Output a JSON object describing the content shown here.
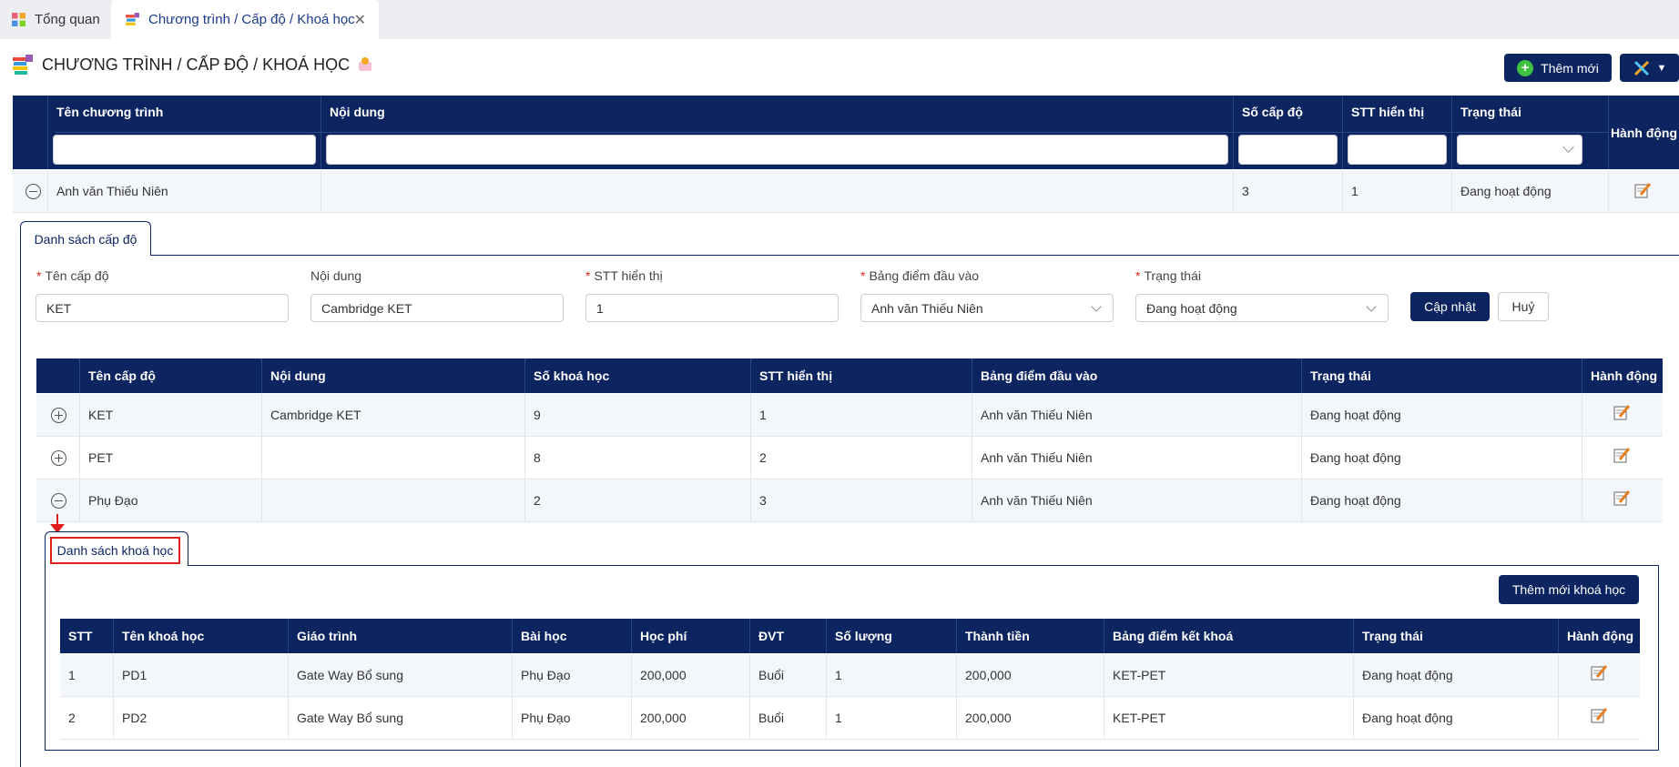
{
  "tabs": [
    {
      "label": "Tổng quan"
    },
    {
      "label": "Chương trình / Cấp độ / Khoá học"
    }
  ],
  "page_title": "CHƯƠNG TRÌNH / CẤP ĐỘ / KHOÁ HỌC",
  "toolbar": {
    "add_label": "Thêm mới"
  },
  "program_grid": {
    "columns": [
      "Tên chương trình",
      "Nội dung",
      "Số cấp độ",
      "STT hiển thị",
      "Trạng thái",
      "Hành động"
    ],
    "rows": [
      {
        "name": "Anh văn Thiếu Niên",
        "content": "",
        "levels": "3",
        "order": "1",
        "status": "Đang hoạt động"
      }
    ]
  },
  "level_panel": {
    "tab_label": "Danh sách cấp độ",
    "form": {
      "name_label": "Tên cấp độ",
      "name_value": "KET",
      "content_label": "Nội dung",
      "content_value": "Cambridge KET",
      "order_label": "STT hiển thị",
      "order_value": "1",
      "score_label": "Bảng điểm đầu vào",
      "score_value": "Anh văn Thiếu Niên",
      "status_label": "Trạng thái",
      "status_value": "Đang hoạt động",
      "update_label": "Cập nhật",
      "cancel_label": "Huỷ"
    },
    "table": {
      "columns": [
        "Tên cấp độ",
        "Nội dung",
        "Số khoá học",
        "STT hiển thị",
        "Bảng điểm đầu vào",
        "Trạng thái",
        "Hành động"
      ],
      "rows": [
        {
          "name": "KET",
          "content": "Cambridge KET",
          "courses": "9",
          "order": "1",
          "score": "Anh văn Thiếu Niên",
          "status": "Đang hoạt động"
        },
        {
          "name": "PET",
          "content": "",
          "courses": "8",
          "order": "2",
          "score": "Anh văn Thiếu Niên",
          "status": "Đang hoạt động"
        },
        {
          "name": "Phụ Đạo",
          "content": "",
          "courses": "2",
          "order": "3",
          "score": "Anh văn Thiếu Niên",
          "status": "Đang hoạt động"
        }
      ]
    }
  },
  "course_panel": {
    "tab_label": "Danh sách khoá học",
    "add_label": "Thêm mới khoá học",
    "table": {
      "columns": [
        "STT",
        "Tên khoá học",
        "Giáo trình",
        "Bài học",
        "Học phí",
        "ĐVT",
        "Số lượng",
        "Thành tiền",
        "Bảng điểm kết khoá",
        "Trạng thái",
        "Hành động"
      ],
      "rows": [
        {
          "stt": "1",
          "name": "PD1",
          "book": "Gate Way Bổ sung",
          "lesson": "Phụ Đạo",
          "fee": "200,000",
          "unit": "Buổi",
          "qty": "1",
          "total": "200,000",
          "score": "KET-PET",
          "status": "Đang hoạt động"
        },
        {
          "stt": "2",
          "name": "PD2",
          "book": "Gate Way Bổ sung",
          "lesson": "Phụ Đạo",
          "fee": "200,000",
          "unit": "Buổi",
          "qty": "1",
          "total": "200,000",
          "score": "KET-PET",
          "status": "Đang hoạt động"
        }
      ]
    }
  },
  "colors": {
    "primary": "#0c2460",
    "highlight": "#e01e1e",
    "row_alt": "#f3f6fa",
    "add_icon": "#3ec13e"
  }
}
